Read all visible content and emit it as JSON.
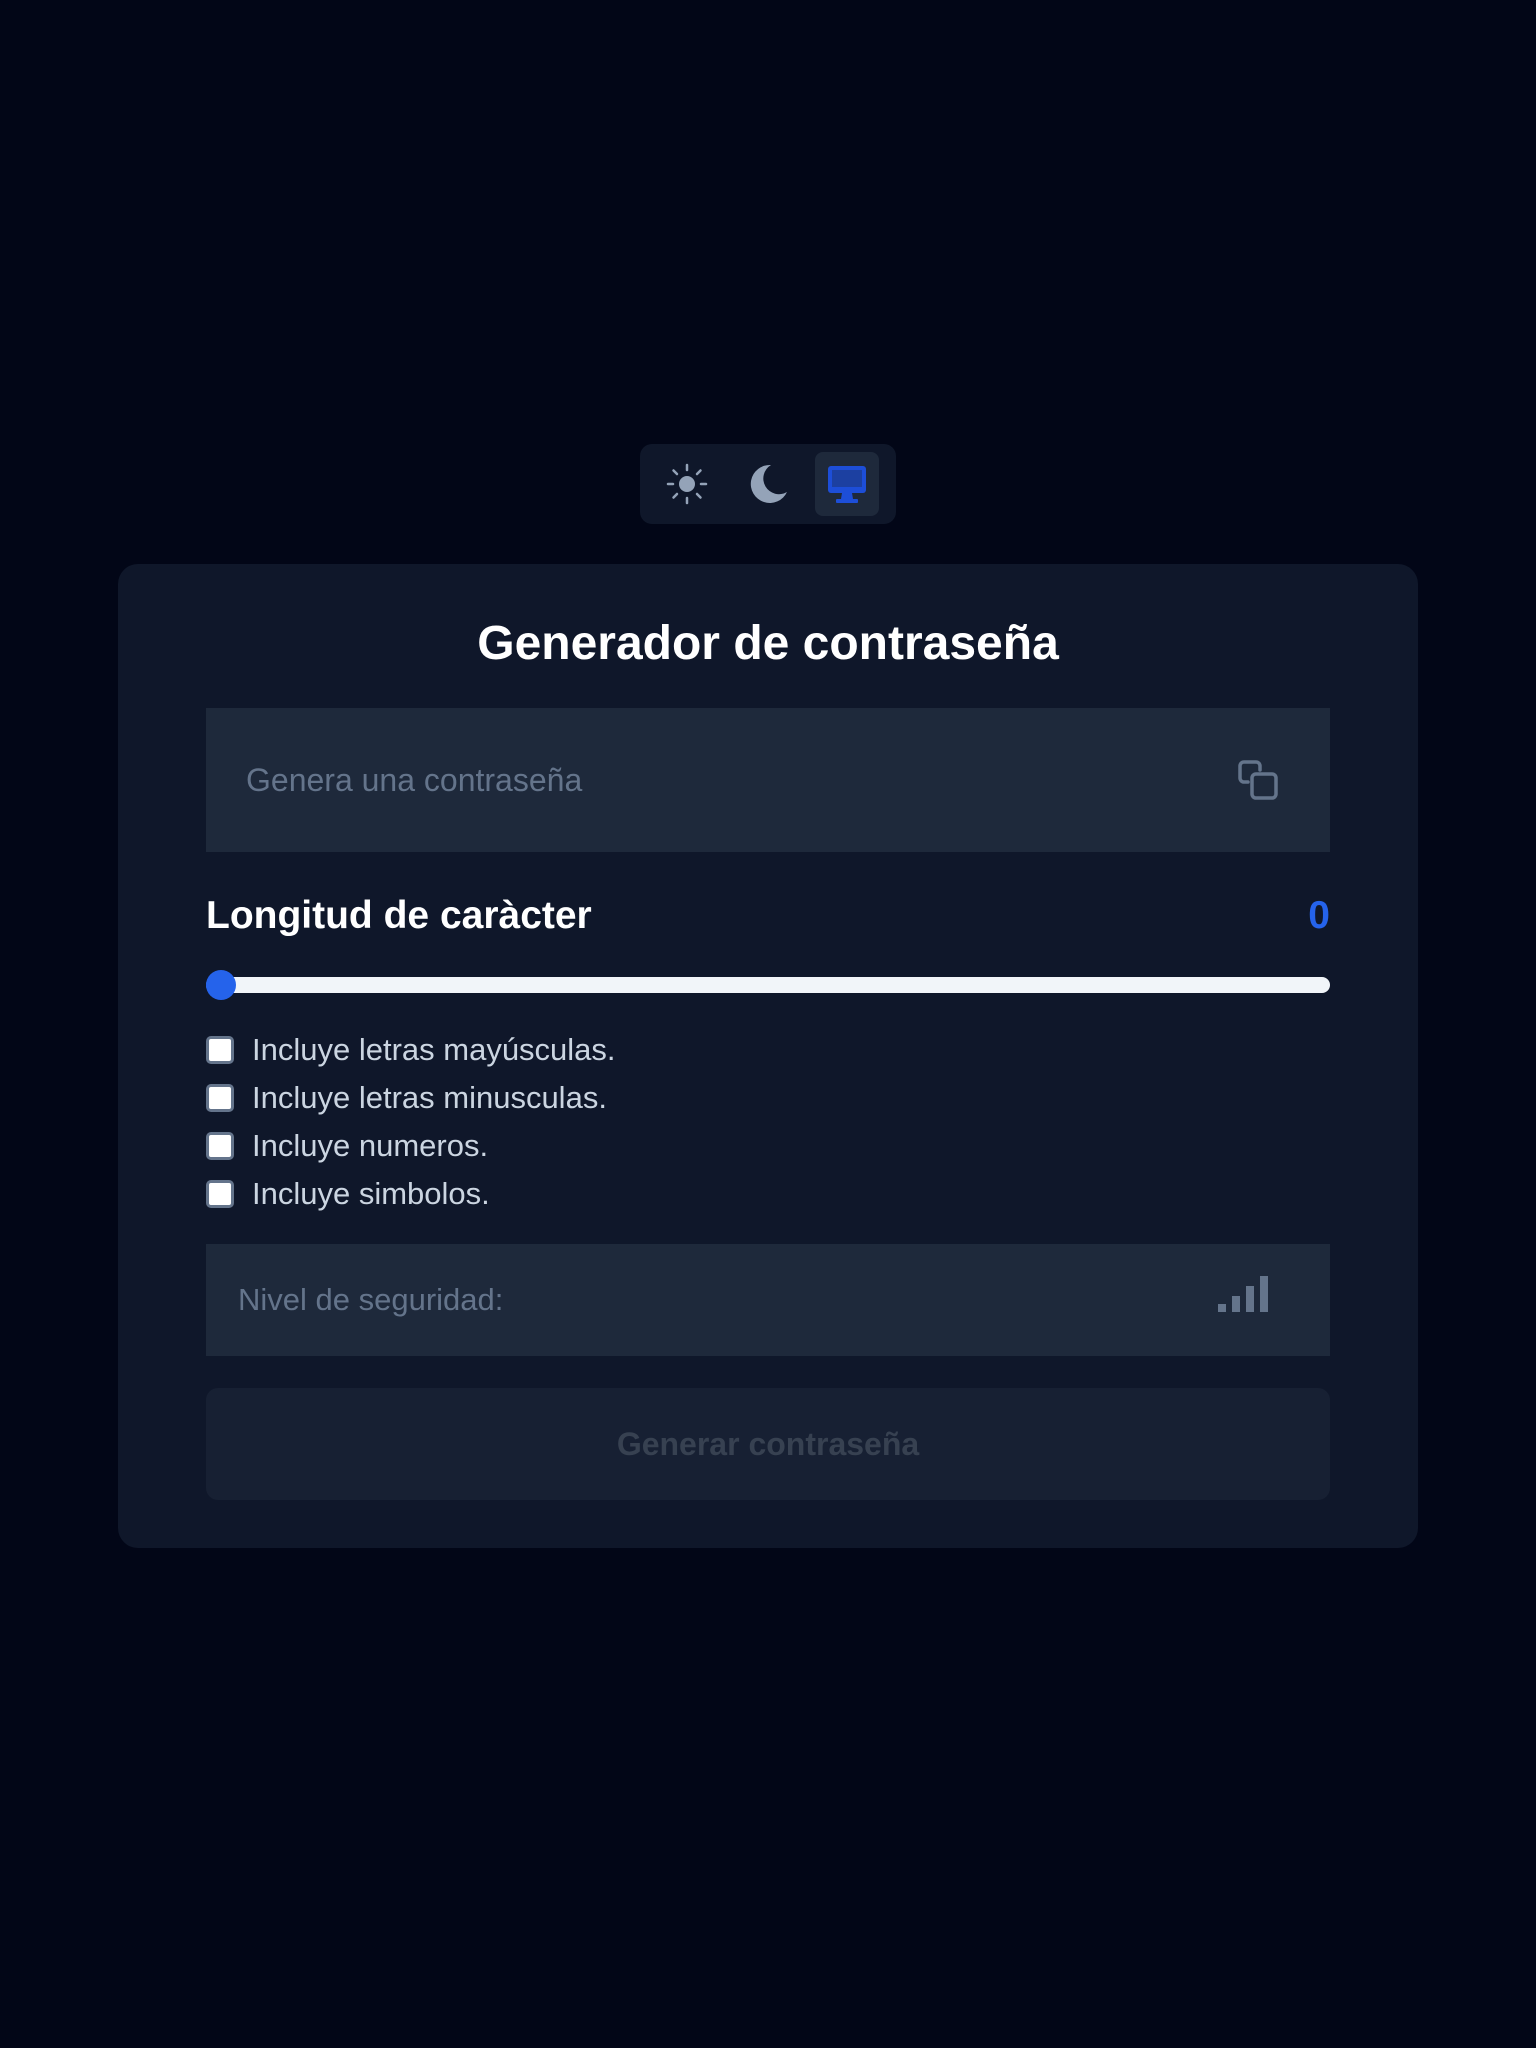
{
  "theme_switcher": {
    "options": [
      {
        "name": "light",
        "icon": "sun-icon"
      },
      {
        "name": "dark",
        "icon": "moon-icon"
      },
      {
        "name": "system",
        "icon": "monitor-icon"
      }
    ],
    "selected": "system"
  },
  "generator": {
    "title": "Generador de contraseña",
    "password": {
      "value": "",
      "placeholder": "Genera una contraseña",
      "copy_icon": "copy-icon"
    },
    "length": {
      "label": "Longitud de caràcter",
      "value": "0",
      "slider_level": 0
    },
    "options": [
      {
        "label": "Incluye letras mayúsculas.",
        "checked": false
      },
      {
        "label": "Incluye letras minusculas.",
        "checked": false
      },
      {
        "label": "Incluye numeros.",
        "checked": false
      },
      {
        "label": "Incluye simbolos.",
        "checked": false
      }
    ],
    "security": {
      "label": "Nivel de seguridad:",
      "icon": "signal-bars-icon"
    },
    "generate_button": {
      "label": "Generar contraseña",
      "disabled": true
    }
  },
  "colors": {
    "page_background": "#020617",
    "card_background": "#0f172a",
    "field_background": "#1e293b",
    "accent": "#2563eb",
    "muted_icon": "#64748b"
  }
}
